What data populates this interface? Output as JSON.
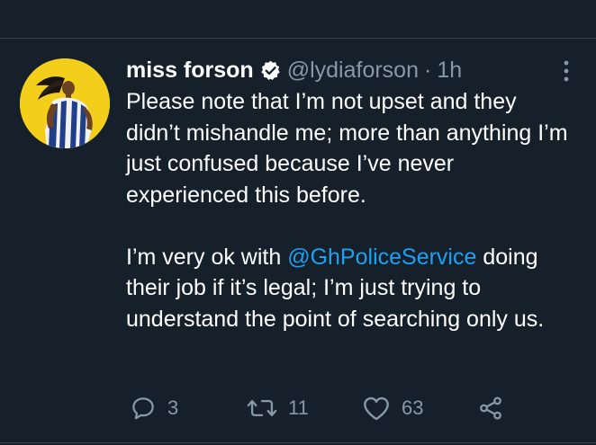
{
  "tweet": {
    "author": {
      "display_name": "miss forson",
      "verified": true,
      "handle": "@lydiaforson",
      "separator": "·",
      "time": "1h"
    },
    "text": {
      "para1": "Please note that I’m not upset and they didn’t mishandle me; more than anything I’m just confused because I’ve never experienced this before.",
      "para2_before": "I’m very ok with ",
      "para2_mention": "@GhPoliceService",
      "para2_after": " doing their job if it’s legal; I’m just trying to understand the point of searching only us."
    },
    "stats": {
      "replies": "3",
      "retweets": "11",
      "likes": "63"
    }
  },
  "colors": {
    "background": "#15202b",
    "text": "#ffffff",
    "secondary": "#8899a6",
    "link": "#1da1f2",
    "avatar_bg": "#f3cf1b"
  },
  "icons": {
    "verified": "verified-badge-icon",
    "more": "more-vertical-icon",
    "reply": "reply-icon",
    "retweet": "retweet-icon",
    "like": "heart-icon",
    "share": "share-icon"
  }
}
